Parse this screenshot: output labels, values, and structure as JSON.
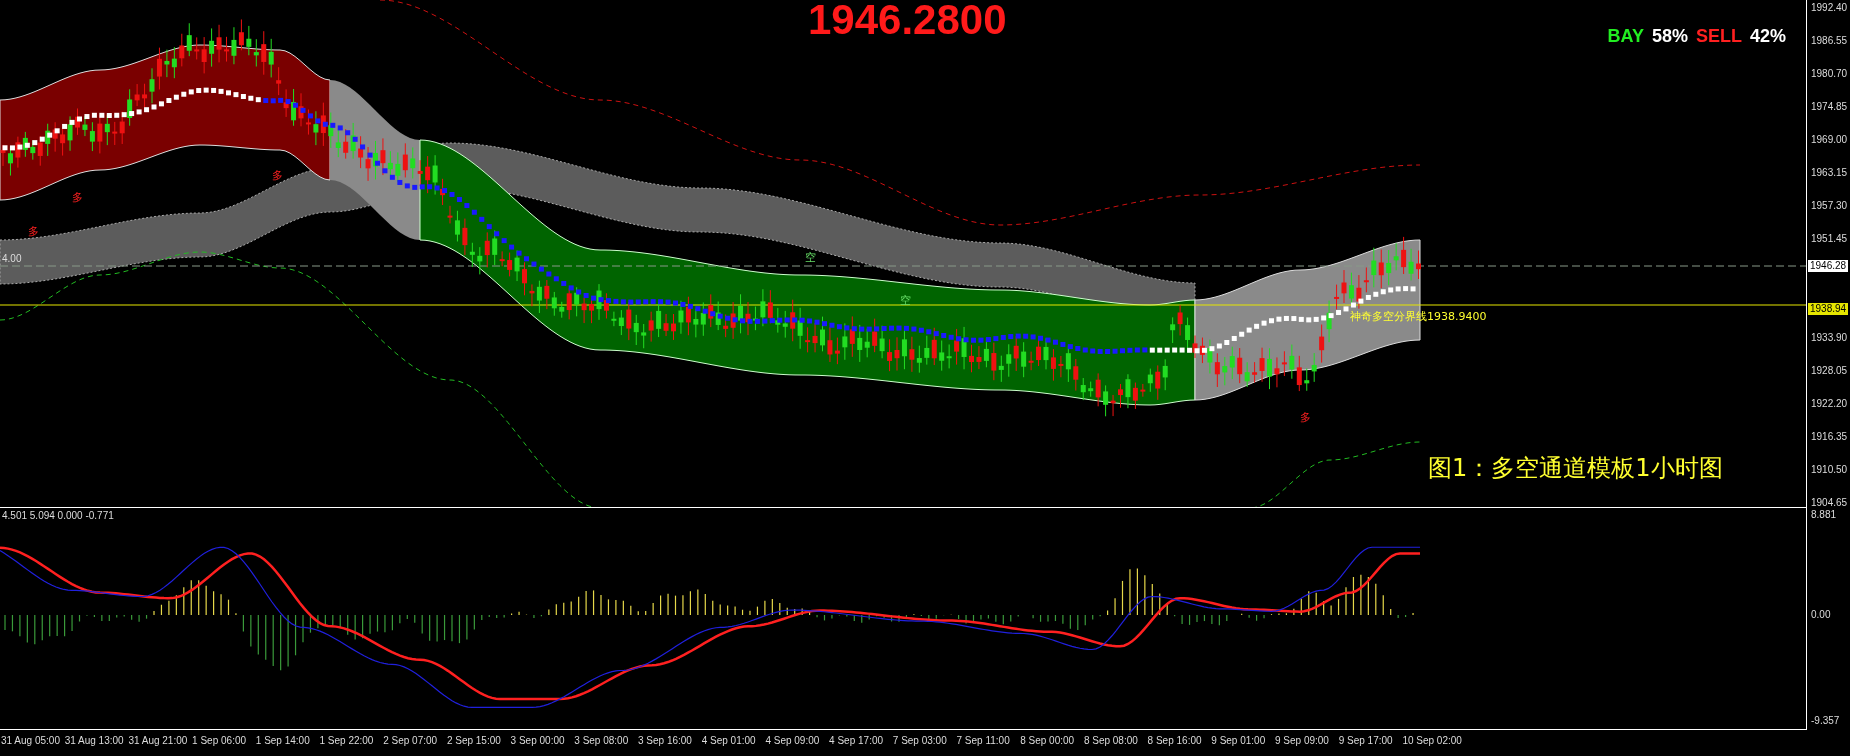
{
  "price_display": "1946.2800",
  "sentiment": {
    "buy_label": "BAY",
    "buy_value": "58%",
    "sell_label": "SELL",
    "sell_value": "42%"
  },
  "chart_title": "图1：多空通道模板1小时图",
  "divider_line": {
    "label": "神奇多空分界线1938.9400"
  },
  "left_label": "4.00",
  "markers": [
    {
      "text": "多",
      "kind": "long"
    },
    {
      "text": "多",
      "kind": "long"
    },
    {
      "text": "多",
      "kind": "long"
    },
    {
      "text": "空",
      "kind": "short"
    },
    {
      "text": "空",
      "kind": "short"
    },
    {
      "text": "多",
      "kind": "long"
    }
  ],
  "price_axis": {
    "labels": [
      "1992.40",
      "1986.55",
      "1980.70",
      "1974.85",
      "1969.00",
      "1963.15",
      "1957.30",
      "1951.45",
      "1933.90",
      "1928.05",
      "1922.20",
      "1916.35",
      "1910.50",
      "1904.65"
    ],
    "current_price": "1946.28",
    "divider_price": "1938.94"
  },
  "indicator": {
    "values": "4.501 5.094 0.000 -0.771",
    "axis_labels": [
      "8.881",
      "0.00",
      "-9.357"
    ]
  },
  "time_axis": {
    "labels": [
      "31 Aug 05:00",
      "31 Aug 13:00",
      "31 Aug 21:00",
      "1 Sep 06:00",
      "1 Sep 14:00",
      "1 Sep 22:00",
      "2 Sep 07:00",
      "2 Sep 15:00",
      "3 Sep 00:00",
      "3 Sep 08:00",
      "3 Sep 16:00",
      "4 Sep 01:00",
      "4 Sep 09:00",
      "4 Sep 17:00",
      "7 Sep 03:00",
      "7 Sep 11:00",
      "8 Sep 00:00",
      "8 Sep 08:00",
      "8 Sep 16:00",
      "9 Sep 01:00",
      "9 Sep 09:00",
      "9 Sep 17:00",
      "10 Sep 02:00"
    ]
  }
}
